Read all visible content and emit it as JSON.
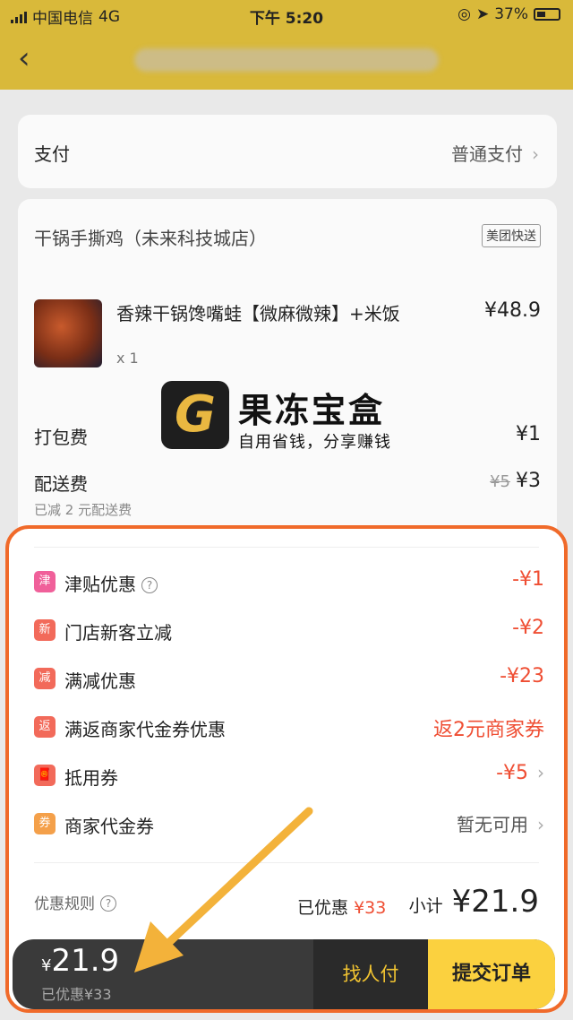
{
  "status": {
    "carrier": "中国电信",
    "network": "4G",
    "time": "下午 5:20",
    "battery": "37%"
  },
  "header": {
    "back_icon": "chevron-left-icon"
  },
  "payment": {
    "label": "支付",
    "value": "普通支付"
  },
  "order": {
    "store": "干锅手撕鸡（未来科技城店）",
    "delivery_tag": "美团快送",
    "item_name": "香辣干锅馋嘴蛙【微麻微辣】+米饭",
    "item_price": "¥48.9",
    "item_qty": "x 1",
    "packing_label": "打包费",
    "packing_value": "¥1",
    "delivery_label": "配送费",
    "delivery_old": "¥5",
    "delivery_value": "¥3",
    "delivery_note": "已减 2 元配送费"
  },
  "watermark": {
    "logo": "G",
    "title": "果冻宝盒",
    "subtitle": "自用省钱，分享赚钱"
  },
  "discounts": [
    {
      "icon": "津",
      "color": "#f0609a",
      "label": "津贴优惠",
      "value": "-¥1",
      "help": true
    },
    {
      "icon": "新",
      "color": "#f26a5a",
      "label": "门店新客立减",
      "value": "-¥2"
    },
    {
      "icon": "减",
      "color": "#f26a5a",
      "label": "满减优惠",
      "value": "-¥23"
    },
    {
      "icon": "返",
      "color": "#f26a5a",
      "label": "满返商家代金券优惠",
      "value": "返2元商家券"
    },
    {
      "icon": "🧧",
      "color": "#f26a5a",
      "label": "抵用券",
      "value": "-¥5",
      "chevron": true
    },
    {
      "icon": "券",
      "color": "#f4a04a",
      "label": "商家代金券",
      "value": "暂无可用",
      "chevron": true
    }
  ],
  "summary": {
    "rules": "优惠规则",
    "saved_label": "已优惠",
    "saved_value": "¥33",
    "subtotal_label": "小计",
    "subtotal_value": "¥21.9"
  },
  "bottom": {
    "price_symbol": "¥",
    "price": "21.9",
    "saved": "已优惠¥33",
    "friend_pay": "找人付",
    "submit": "提交订单"
  }
}
